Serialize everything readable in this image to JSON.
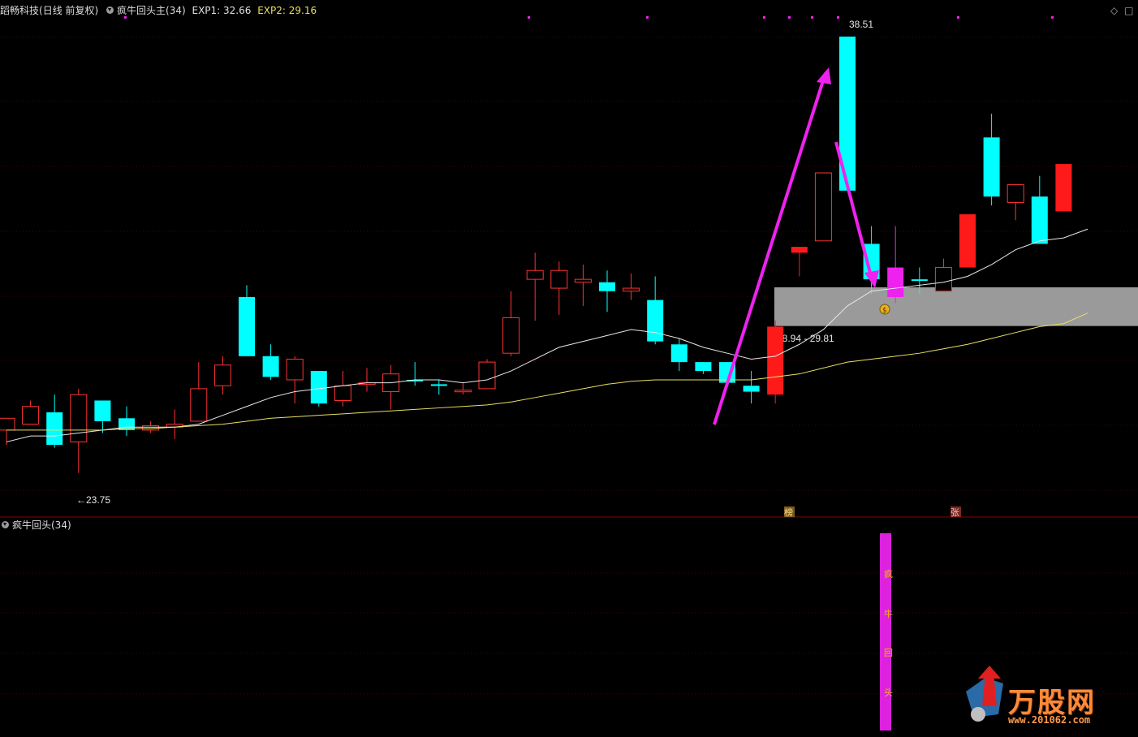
{
  "header": {
    "stock_name": "蹈畅科技",
    "period_label": "(日线 前复权)",
    "indicator_label": "疯牛回头主(34)",
    "exp1_label": "EXP1: 32.66",
    "exp2_label": "EXP2: 29.16"
  },
  "sub_header": {
    "indicator_label": "疯牛回头(34)"
  },
  "annotations": {
    "high_label": "38.51",
    "low_label": "←23.75",
    "zone_label": "28.94 - 29.81",
    "tag_bang": "榜",
    "tag_zhang": "张",
    "sub_chars": [
      "疯",
      "牛",
      "回",
      "头"
    ],
    "coin_symbol": "$"
  },
  "watermark": {
    "brand": "万股网",
    "url": "www.201062.com"
  },
  "colors": {
    "up": "#ff1a1a",
    "up_hollow": "#ff3333",
    "down": "#00ffff",
    "ma_white": "#e8e8e8",
    "ma_yellow": "#e8e060",
    "arrow": "#ee22ee",
    "zone": "#9a9a9a",
    "grid": "#4a0000",
    "exp1": "#e0e0e0",
    "exp2": "#e8e060"
  },
  "chart_data": {
    "type": "candlestick",
    "y_range": [
      23.0,
      39.2
    ],
    "candles": [
      {
        "open": 25.2,
        "high": 25.6,
        "low": 24.7,
        "close": 25.6,
        "style": "hollow"
      },
      {
        "open": 25.4,
        "high": 26.2,
        "low": 25.4,
        "close": 26.0,
        "style": "hollow"
      },
      {
        "open": 25.8,
        "high": 26.4,
        "low": 24.6,
        "close": 24.7,
        "style": "down"
      },
      {
        "open": 24.8,
        "high": 26.6,
        "low": 23.75,
        "close": 26.4,
        "style": "hollow"
      },
      {
        "open": 26.2,
        "high": 26.2,
        "low": 25.1,
        "close": 25.5,
        "style": "down"
      },
      {
        "open": 25.6,
        "high": 26.0,
        "low": 25.0,
        "close": 25.2,
        "style": "down"
      },
      {
        "open": 25.2,
        "high": 25.5,
        "low": 25.1,
        "close": 25.35,
        "style": "hollow"
      },
      {
        "open": 25.3,
        "high": 25.9,
        "low": 24.9,
        "close": 25.4,
        "style": "hollow"
      },
      {
        "open": 25.5,
        "high": 27.5,
        "low": 25.5,
        "close": 26.6,
        "style": "hollow"
      },
      {
        "open": 26.7,
        "high": 27.7,
        "low": 26.4,
        "close": 27.4,
        "style": "hollow"
      },
      {
        "open": 29.7,
        "high": 30.1,
        "low": 27.8,
        "close": 27.7,
        "style": "down"
      },
      {
        "open": 27.7,
        "high": 28.1,
        "low": 26.9,
        "close": 27.0,
        "style": "down"
      },
      {
        "open": 26.9,
        "high": 27.7,
        "low": 26.1,
        "close": 27.6,
        "style": "hollow"
      },
      {
        "open": 27.2,
        "high": 27.2,
        "low": 26.0,
        "close": 26.1,
        "style": "down"
      },
      {
        "open": 26.2,
        "high": 27.2,
        "low": 26.0,
        "close": 26.7,
        "style": "hollow"
      },
      {
        "open": 26.8,
        "high": 27.3,
        "low": 26.5,
        "close": 26.8,
        "style": "hollow"
      },
      {
        "open": 26.5,
        "high": 27.4,
        "low": 25.9,
        "close": 27.1,
        "style": "hollow"
      },
      {
        "open": 26.9,
        "high": 27.5,
        "low": 26.7,
        "close": 26.9,
        "style": "down"
      },
      {
        "open": 26.7,
        "high": 26.9,
        "low": 26.4,
        "close": 26.75,
        "style": "down"
      },
      {
        "open": 26.5,
        "high": 26.8,
        "low": 26.4,
        "close": 26.55,
        "style": "hollow"
      },
      {
        "open": 26.6,
        "high": 27.6,
        "low": 26.6,
        "close": 27.5,
        "style": "hollow"
      },
      {
        "open": 27.8,
        "high": 29.9,
        "low": 27.7,
        "close": 29.0,
        "style": "hollow"
      },
      {
        "open": 30.3,
        "high": 31.2,
        "low": 28.9,
        "close": 30.6,
        "style": "hollow"
      },
      {
        "open": 30.0,
        "high": 30.9,
        "low": 29.1,
        "close": 30.6,
        "style": "hollow"
      },
      {
        "open": 30.2,
        "high": 30.8,
        "low": 29.4,
        "close": 30.3,
        "style": "hollow"
      },
      {
        "open": 30.2,
        "high": 30.6,
        "low": 29.2,
        "close": 29.9,
        "style": "down"
      },
      {
        "open": 29.9,
        "high": 30.5,
        "low": 29.6,
        "close": 30.0,
        "style": "hollow"
      },
      {
        "open": 29.6,
        "high": 30.4,
        "low": 28.1,
        "close": 28.2,
        "style": "down"
      },
      {
        "open": 28.1,
        "high": 28.3,
        "low": 27.2,
        "close": 27.5,
        "style": "down"
      },
      {
        "open": 27.5,
        "high": 27.5,
        "low": 27.1,
        "close": 27.2,
        "style": "down"
      },
      {
        "open": 27.5,
        "high": 27.5,
        "low": 26.7,
        "close": 26.8,
        "style": "down"
      },
      {
        "open": 26.7,
        "high": 27.2,
        "low": 26.1,
        "close": 26.5,
        "style": "down"
      },
      {
        "open": 26.4,
        "high": 28.9,
        "low": 26.1,
        "close": 28.7,
        "style": "up"
      },
      {
        "open": 31.2,
        "high": 31.4,
        "low": 30.4,
        "close": 31.4,
        "style": "up"
      },
      {
        "open": 31.6,
        "high": 33.9,
        "low": 31.6,
        "close": 33.9,
        "style": "hollow"
      },
      {
        "open": 38.51,
        "high": 38.51,
        "low": 33.3,
        "close": 33.3,
        "style": "down"
      },
      {
        "open": 31.5,
        "high": 32.1,
        "low": 29.8,
        "close": 30.3,
        "style": "down"
      },
      {
        "open": 30.7,
        "high": 32.1,
        "low": 29.5,
        "close": 29.7,
        "style": "magenta"
      },
      {
        "open": 30.3,
        "high": 30.7,
        "low": 29.8,
        "close": 30.3,
        "style": "down"
      },
      {
        "open": 29.9,
        "high": 31.0,
        "low": 29.9,
        "close": 30.7,
        "style": "hollow"
      },
      {
        "open": 30.7,
        "high": 32.5,
        "low": 30.7,
        "close": 32.5,
        "style": "up"
      },
      {
        "open": 35.1,
        "high": 35.9,
        "low": 32.8,
        "close": 33.1,
        "style": "down"
      },
      {
        "open": 32.9,
        "high": 33.5,
        "low": 32.3,
        "close": 33.5,
        "style": "hollow"
      },
      {
        "open": 33.1,
        "high": 33.8,
        "low": 31.5,
        "close": 31.5,
        "style": "down"
      },
      {
        "open": 32.6,
        "high": 34.2,
        "low": 32.6,
        "close": 34.2,
        "style": "up"
      }
    ],
    "ma_white": [
      24.8,
      25.0,
      25.0,
      25.1,
      25.2,
      25.3,
      25.3,
      25.3,
      25.4,
      25.7,
      26.0,
      26.3,
      26.5,
      26.6,
      26.7,
      26.8,
      26.8,
      26.9,
      26.9,
      26.8,
      26.9,
      27.2,
      27.6,
      28.0,
      28.2,
      28.4,
      28.6,
      28.5,
      28.3,
      28.0,
      27.8,
      27.6,
      27.7,
      28.1,
      28.6,
      29.4,
      29.9,
      30.0,
      30.1,
      30.2,
      30.4,
      30.8,
      31.3,
      31.6,
      31.7,
      32.0
    ],
    "ma_yellow": [
      25.2,
      25.2,
      25.2,
      25.2,
      25.2,
      25.25,
      25.25,
      25.3,
      25.35,
      25.4,
      25.5,
      25.6,
      25.65,
      25.7,
      25.75,
      25.8,
      25.85,
      25.9,
      25.95,
      26.0,
      26.05,
      26.15,
      26.3,
      26.45,
      26.6,
      26.75,
      26.85,
      26.9,
      26.9,
      26.9,
      26.9,
      26.9,
      27.0,
      27.1,
      27.3,
      27.5,
      27.6,
      27.7,
      27.8,
      27.95,
      28.1,
      28.3,
      28.5,
      28.7,
      28.8,
      29.16
    ],
    "zone": {
      "low": 28.94,
      "high": 29.81
    }
  }
}
